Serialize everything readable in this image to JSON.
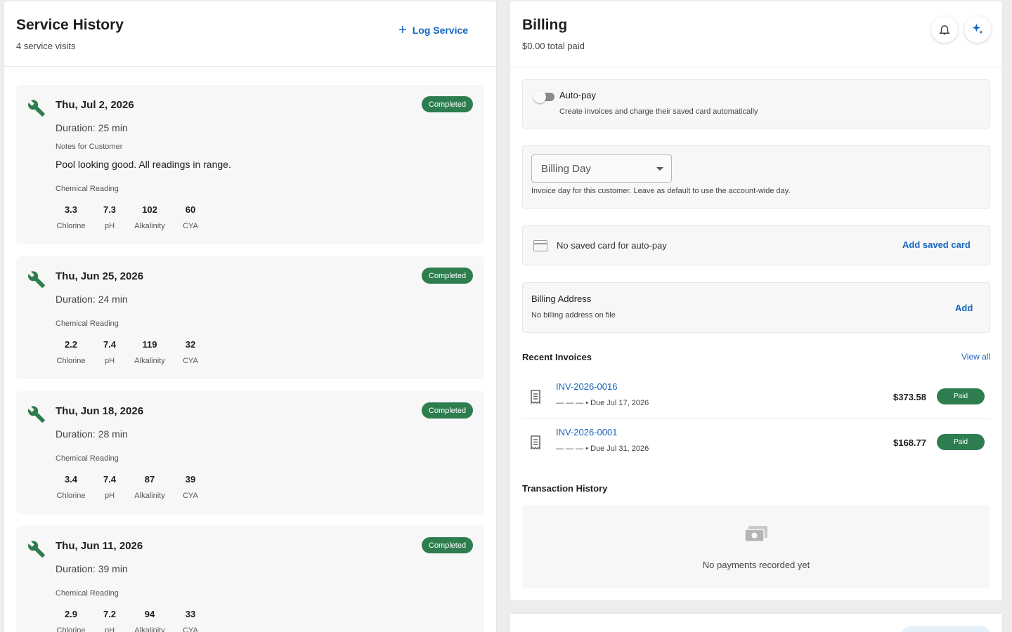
{
  "service_history": {
    "title": "Service History",
    "subtitle": "4 service visits",
    "log_button": "Log Service",
    "visits": [
      {
        "date": "Thu, Jul 2, 2026",
        "duration": "Duration: 25 min",
        "status": "Completed",
        "notes_label": "Notes for Customer",
        "notes": "Pool looking good. All readings in range.",
        "chem_label": "Chemical Reading",
        "readings": [
          {
            "value": "3.3",
            "label": "Chlorine"
          },
          {
            "value": "7.3",
            "label": "pH"
          },
          {
            "value": "102",
            "label": "Alkalinity"
          },
          {
            "value": "60",
            "label": "CYA"
          }
        ]
      },
      {
        "date": "Thu, Jun 25, 2026",
        "duration": "Duration: 24 min",
        "status": "Completed",
        "chem_label": "Chemical Reading",
        "readings": [
          {
            "value": "2.2",
            "label": "Chlorine"
          },
          {
            "value": "7.4",
            "label": "pH"
          },
          {
            "value": "119",
            "label": "Alkalinity"
          },
          {
            "value": "32",
            "label": "CYA"
          }
        ]
      },
      {
        "date": "Thu, Jun 18, 2026",
        "duration": "Duration: 28 min",
        "status": "Completed",
        "chem_label": "Chemical Reading",
        "readings": [
          {
            "value": "3.4",
            "label": "Chlorine"
          },
          {
            "value": "7.4",
            "label": "pH"
          },
          {
            "value": "87",
            "label": "Alkalinity"
          },
          {
            "value": "39",
            "label": "CYA"
          }
        ]
      },
      {
        "date": "Thu, Jun 11, 2026",
        "duration": "Duration: 39 min",
        "status": "Completed",
        "chem_label": "Chemical Reading",
        "readings": [
          {
            "value": "2.9",
            "label": "Chlorine"
          },
          {
            "value": "7.2",
            "label": "pH"
          },
          {
            "value": "94",
            "label": "Alkalinity"
          },
          {
            "value": "33",
            "label": "CYA"
          }
        ]
      }
    ]
  },
  "billing": {
    "title": "Billing",
    "subtitle": "$0.00 total paid",
    "icons": {
      "notifications": "bell-icon",
      "assistant": "sparkle-icon"
    },
    "autopay": {
      "label": "Auto-pay",
      "description": "Create invoices and charge their saved card automatically",
      "enabled": false
    },
    "billing_day": {
      "label": "Billing Day",
      "help": "Invoice day for this customer. Leave as default to use the account-wide day."
    },
    "saved_card": {
      "text": "No saved card for auto-pay",
      "action": "Add saved card"
    },
    "billing_address": {
      "title": "Billing Address",
      "text": "No billing address on file",
      "action": "Add"
    },
    "recent_invoices": {
      "title": "Recent Invoices",
      "view_all": "View all",
      "items": [
        {
          "number": "INV-2026-0016",
          "due": "— — — • Due Jul 17, 2026",
          "amount": "$373.58",
          "status": "Paid"
        },
        {
          "number": "INV-2026-0001",
          "due": "— — — • Due Jul 31, 2026",
          "amount": "$168.77",
          "status": "Paid"
        }
      ]
    },
    "transactions": {
      "title": "Transaction History",
      "empty": "No payments recorded yet"
    }
  },
  "colors": {
    "accent": "#1565c0",
    "success": "#2e7d4f",
    "wrench": "#2e7d4f"
  }
}
